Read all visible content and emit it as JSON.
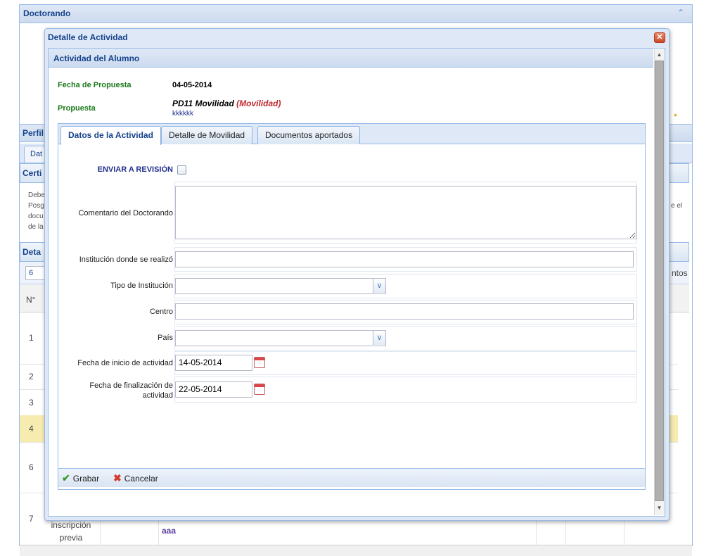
{
  "background": {
    "panel_title": "Doctorando",
    "left_labels": [
      "Perfil",
      "Dat",
      "Certi",
      "Deta",
      "6",
      "N°"
    ],
    "left_paragraph": [
      "Debe",
      "Posg",
      "docu",
      "de la"
    ],
    "right_fragments": [
      "e el",
      "ntos"
    ],
    "row_numbers": [
      "1",
      "2",
      "3",
      "4",
      "6",
      "7"
    ],
    "bottom_cell_text": [
      "inscripción",
      "previa"
    ],
    "bottom_link": "aaa"
  },
  "window": {
    "title": "Detalle de Actividad",
    "close_icon": "close-icon"
  },
  "panel": {
    "title": "Actividad del Alumno",
    "proposal_date_label": "Fecha de Propuesta",
    "proposal_date": "04-05-2014",
    "proposal_label": "Propuesta",
    "proposal_name": "PD11 Movilidad",
    "proposal_type": "(Movilidad)",
    "proposal_code": "kkkkkk"
  },
  "tabs": [
    {
      "label": "Datos de la Actividad",
      "active": true
    },
    {
      "label": "Detalle de Movilidad",
      "active": false
    },
    {
      "label": "Documentos aportados",
      "active": false
    }
  ],
  "form": {
    "send_review_label": "ENVIAR A REVISIÓN",
    "send_review_checked": false,
    "comment_label": "Comentario del Doctorando",
    "comment_value": "",
    "institution_label": "Institución donde se realizó",
    "institution_value": "",
    "institution_type_label": "Tipo de Institución",
    "institution_type_value": "",
    "center_label": "Centro",
    "center_value": "",
    "country_label": "País",
    "country_value": "",
    "start_date_label": "Fecha de inicio de actividad",
    "start_date_value": "14-05-2014",
    "end_date_label_line1": "Fecha de finalización de",
    "end_date_label_line2": "actividad",
    "end_date_value": "22-05-2014"
  },
  "toolbar": {
    "save_label": "Grabar",
    "cancel_label": "Cancelar"
  },
  "colors": {
    "header_blue": "#15428b",
    "label_green": "#1a7a1a",
    "type_red": "#c0272d",
    "row_highlight": "#f7ecb0"
  }
}
